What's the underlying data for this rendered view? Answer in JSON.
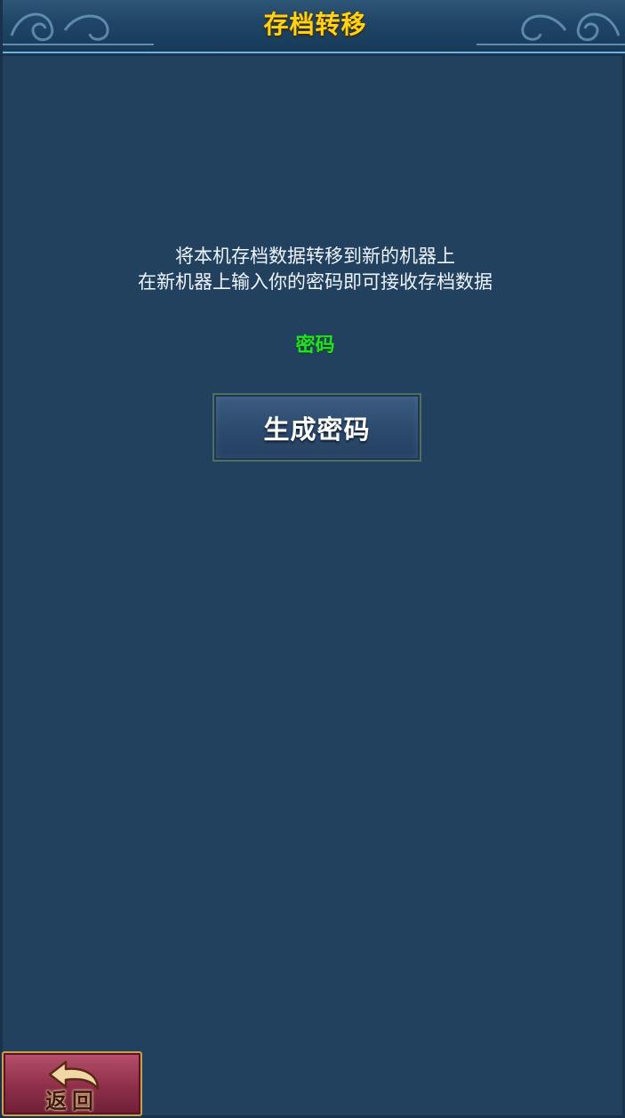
{
  "header": {
    "title": "存档转移"
  },
  "main": {
    "description_lines": [
      "将本机存档数据转移到新的机器上",
      "在新机器上输入你的密码即可接收存档数据"
    ],
    "password_label": "密码",
    "generate_button_label": "生成密码"
  },
  "footer": {
    "back_button_label": "返回",
    "back_icon": "curved-back-arrow-icon"
  },
  "colors": {
    "title": "#ffd21a",
    "password_label": "#22e022",
    "panel_background": "#22415e",
    "back_button": "#8e2f4a"
  }
}
